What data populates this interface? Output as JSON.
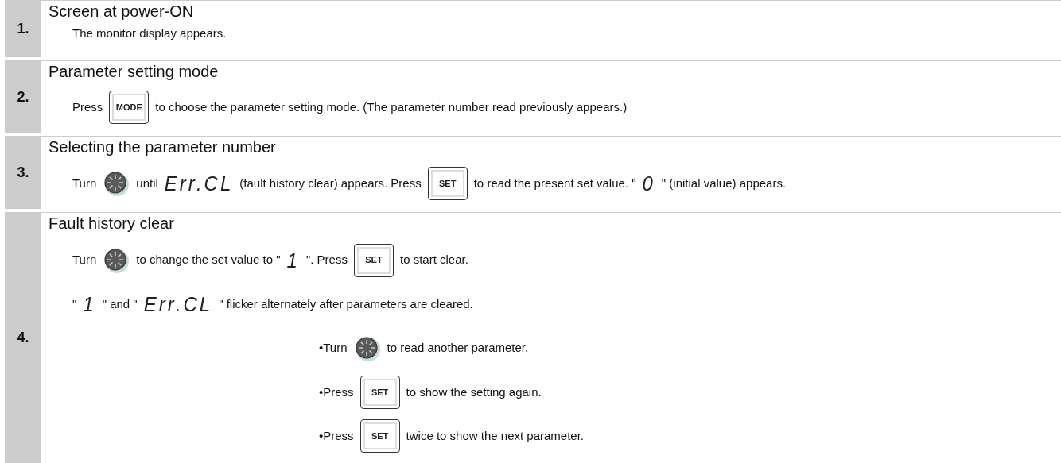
{
  "steps": [
    {
      "number": "1.",
      "title": "Screen at power-ON",
      "lines": [
        [
          {
            "kind": "text",
            "text": "The monitor display appears."
          }
        ]
      ]
    },
    {
      "number": "2.",
      "title": "Parameter setting mode",
      "lines": [
        [
          {
            "kind": "text",
            "text": "Press"
          },
          {
            "kind": "key",
            "text": "MODE"
          },
          {
            "kind": "text",
            "text": "to choose the parameter setting mode. (The parameter number read previously appears.)"
          }
        ]
      ]
    },
    {
      "number": "3.",
      "title": "Selecting the parameter number",
      "lines": [
        [
          {
            "kind": "text",
            "text": "Turn"
          },
          {
            "kind": "dial"
          },
          {
            "kind": "text",
            "text": "until"
          },
          {
            "kind": "display",
            "text": "Err.CL"
          },
          {
            "kind": "text",
            "text": "(fault history clear) appears. Press"
          },
          {
            "kind": "key",
            "text": "SET"
          },
          {
            "kind": "text",
            "text": "to read the present set value. \""
          },
          {
            "kind": "display",
            "text": "0"
          },
          {
            "kind": "text",
            "text": "\" (initial value) appears."
          }
        ]
      ]
    },
    {
      "number": "4.",
      "title": "Fault history clear",
      "lines": [
        [
          {
            "kind": "text",
            "text": "Turn"
          },
          {
            "kind": "dial"
          },
          {
            "kind": "text",
            "text": "to change the set value to \""
          },
          {
            "kind": "display",
            "text": "1"
          },
          {
            "kind": "text",
            "text": "\". Press"
          },
          {
            "kind": "key",
            "text": "SET"
          },
          {
            "kind": "text",
            "text": "to start clear."
          }
        ],
        [
          {
            "kind": "text",
            "text": "\""
          },
          {
            "kind": "display",
            "text": "1"
          },
          {
            "kind": "text",
            "text": "\" and \""
          },
          {
            "kind": "display",
            "text": "Err.CL"
          },
          {
            "kind": "text",
            "text": "\" flicker alternately after parameters are cleared."
          }
        ]
      ],
      "notes": [
        [
          {
            "kind": "text",
            "text": "•Turn"
          },
          {
            "kind": "dial"
          },
          {
            "kind": "text",
            "text": "to read another parameter."
          }
        ],
        [
          {
            "kind": "text",
            "text": "•Press"
          },
          {
            "kind": "key",
            "text": "SET"
          },
          {
            "kind": "text",
            "text": "to show the setting again."
          }
        ],
        [
          {
            "kind": "text",
            "text": "•Press"
          },
          {
            "kind": "key",
            "text": "SET"
          },
          {
            "kind": "text",
            "text": "twice to show the next parameter."
          }
        ]
      ]
    }
  ]
}
